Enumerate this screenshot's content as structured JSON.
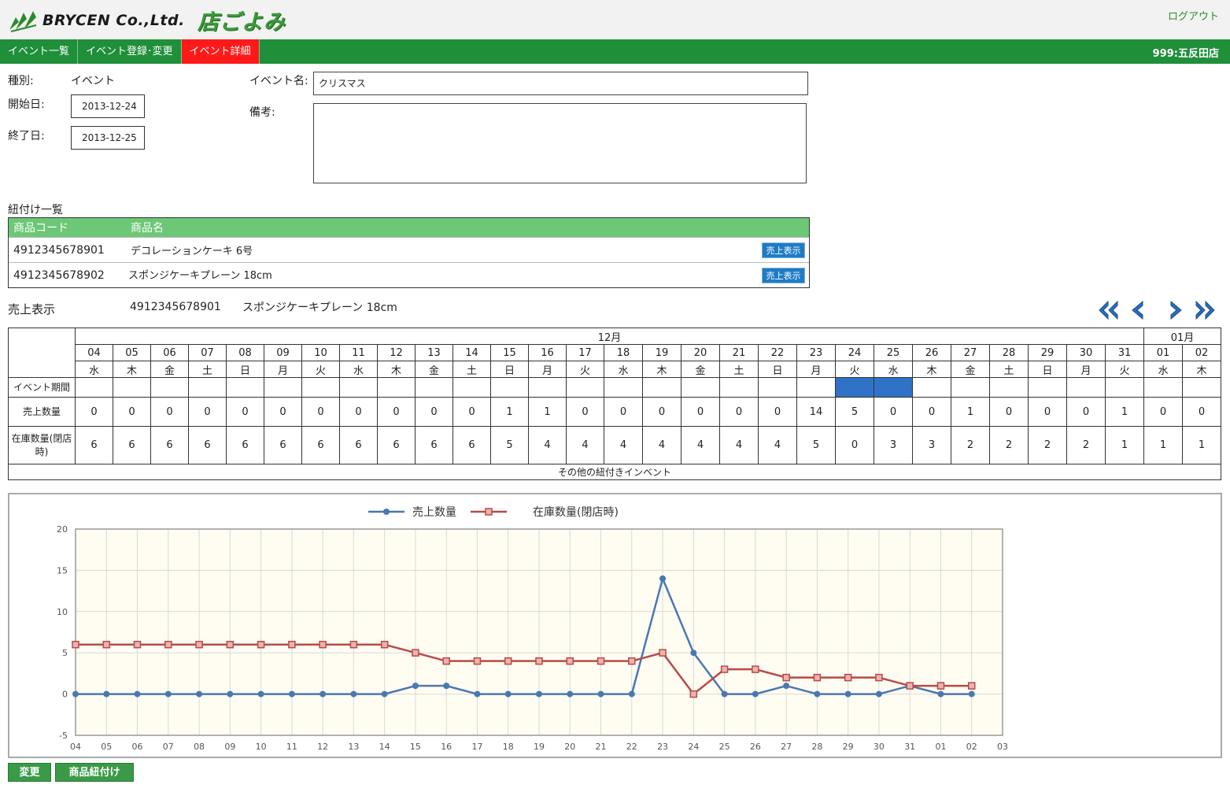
{
  "header": {
    "company": "BRYCEN Co.,Ltd.",
    "app_name": "店ごよみ",
    "logout": "ログアウト",
    "store": "999:五反田店"
  },
  "nav": {
    "tabs": [
      {
        "label": "イベント一覧",
        "active": false
      },
      {
        "label": "イベント登録･変更",
        "active": false
      },
      {
        "label": "イベント詳細",
        "active": true
      }
    ]
  },
  "form": {
    "type_label": "種別:",
    "type_value": "イベント",
    "start_label": "開始日:",
    "start_value": "2013-12-24",
    "end_label": "終了日:",
    "end_value": "2013-12-25",
    "name_label": "イベント名:",
    "name_value": "クリスマス",
    "note_label": "備考:",
    "note_value": ""
  },
  "linked": {
    "title": "紐付け一覧",
    "col_code": "商品コード",
    "col_name": "商品名",
    "rows": [
      {
        "code": "4912345678901",
        "name": "デコレーションケーキ  6号",
        "button": "売上表示"
      },
      {
        "code": "4912345678902",
        "name": "スポンジケーキプレーン  18cm",
        "button": "売上表示"
      }
    ]
  },
  "sales": {
    "label": "売上表示",
    "code": "4912345678901",
    "name": "スポンジケーキプレーン  18cm"
  },
  "calendar": {
    "months": [
      {
        "label": "12月",
        "span": 28
      },
      {
        "label": "01月",
        "span": 2
      }
    ],
    "days": [
      "04",
      "05",
      "06",
      "07",
      "08",
      "09",
      "10",
      "11",
      "12",
      "13",
      "14",
      "15",
      "16",
      "17",
      "18",
      "19",
      "20",
      "21",
      "22",
      "23",
      "24",
      "25",
      "26",
      "27",
      "28",
      "29",
      "30",
      "31",
      "01",
      "02"
    ],
    "weekdays": [
      "水",
      "木",
      "金",
      "土",
      "日",
      "月",
      "火",
      "水",
      "木",
      "金",
      "土",
      "日",
      "月",
      "火",
      "水",
      "木",
      "金",
      "土",
      "日",
      "月",
      "火",
      "水",
      "木",
      "金",
      "土",
      "日",
      "月",
      "火",
      "水",
      "木"
    ],
    "event_row_label": "イベント期間",
    "event_days": [
      "24",
      "25"
    ],
    "sales_row_label": "売上数量",
    "sales_qty": [
      0,
      0,
      0,
      0,
      0,
      0,
      0,
      0,
      0,
      0,
      0,
      1,
      1,
      0,
      0,
      0,
      0,
      0,
      0,
      14,
      5,
      0,
      0,
      1,
      0,
      0,
      0,
      1,
      0,
      0
    ],
    "stock_row_label": "在庫数量(閉店時)",
    "stock_qty": [
      6,
      6,
      6,
      6,
      6,
      6,
      6,
      6,
      6,
      6,
      6,
      5,
      4,
      4,
      4,
      4,
      4,
      4,
      4,
      5,
      0,
      3,
      3,
      2,
      2,
      2,
      2,
      1,
      1,
      1
    ],
    "footer": "その他の紐付きインベント"
  },
  "chart_data": {
    "type": "line",
    "x": [
      "04",
      "05",
      "06",
      "07",
      "08",
      "09",
      "10",
      "11",
      "12",
      "13",
      "14",
      "15",
      "16",
      "17",
      "18",
      "19",
      "20",
      "21",
      "22",
      "23",
      "24",
      "25",
      "26",
      "27",
      "28",
      "29",
      "30",
      "31",
      "01",
      "02"
    ],
    "x_ticks": [
      "04",
      "05",
      "06",
      "07",
      "08",
      "09",
      "10",
      "11",
      "12",
      "13",
      "14",
      "15",
      "16",
      "17",
      "18",
      "19",
      "20",
      "21",
      "22",
      "23",
      "24",
      "25",
      "26",
      "27",
      "28",
      "29",
      "30",
      "31",
      "01",
      "02",
      "03"
    ],
    "y_ticks": [
      20,
      15,
      10,
      5,
      0,
      -5
    ],
    "ylim": [
      -5,
      20
    ],
    "grid": true,
    "legend_position": "top-center",
    "series": [
      {
        "name": "売上数量",
        "color": "#4a78b0",
        "marker": "circle",
        "values": [
          0,
          0,
          0,
          0,
          0,
          0,
          0,
          0,
          0,
          0,
          0,
          1,
          1,
          0,
          0,
          0,
          0,
          0,
          0,
          14,
          5,
          0,
          0,
          1,
          0,
          0,
          0,
          1,
          0,
          0
        ]
      },
      {
        "name": "在庫数量(閉店時)",
        "color": "#b94a48",
        "marker": "square",
        "values": [
          6,
          6,
          6,
          6,
          6,
          6,
          6,
          6,
          6,
          6,
          6,
          5,
          4,
          4,
          4,
          4,
          4,
          4,
          4,
          5,
          0,
          3,
          3,
          2,
          2,
          2,
          2,
          1,
          1,
          1
        ]
      }
    ]
  },
  "actions": {
    "change": "変更",
    "link_products": "商品紐付け"
  }
}
